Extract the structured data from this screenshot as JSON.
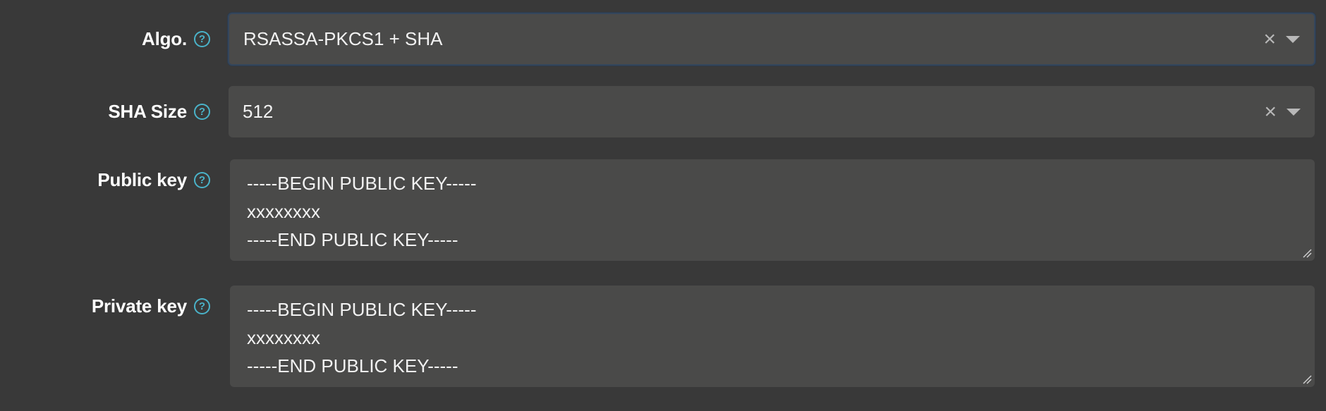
{
  "fields": {
    "algo": {
      "label": "Algo.",
      "value": "RSASSA-PKCS1 + SHA",
      "help_glyph": "?",
      "clear_glyph": "×"
    },
    "sha_size": {
      "label": "SHA Size",
      "value": "512",
      "help_glyph": "?",
      "clear_glyph": "×"
    },
    "public_key": {
      "label": "Public key",
      "help_glyph": "?",
      "lines": [
        "-----BEGIN PUBLIC KEY-----",
        "xxxxxxxx",
        "-----END PUBLIC KEY-----"
      ]
    },
    "private_key": {
      "label": "Private key",
      "help_glyph": "?",
      "lines": [
        "-----BEGIN PUBLIC KEY-----",
        "xxxxxxxx",
        "-----END PUBLIC KEY-----"
      ]
    }
  },
  "colors": {
    "background": "#393939",
    "field": "#4a4a49",
    "help_accent": "#4ab3c9",
    "focus_border": "#34465c"
  },
  "icons": {
    "help": "question-circle",
    "clear": "times",
    "caret": "caret-down",
    "resize": "resize-grip"
  }
}
